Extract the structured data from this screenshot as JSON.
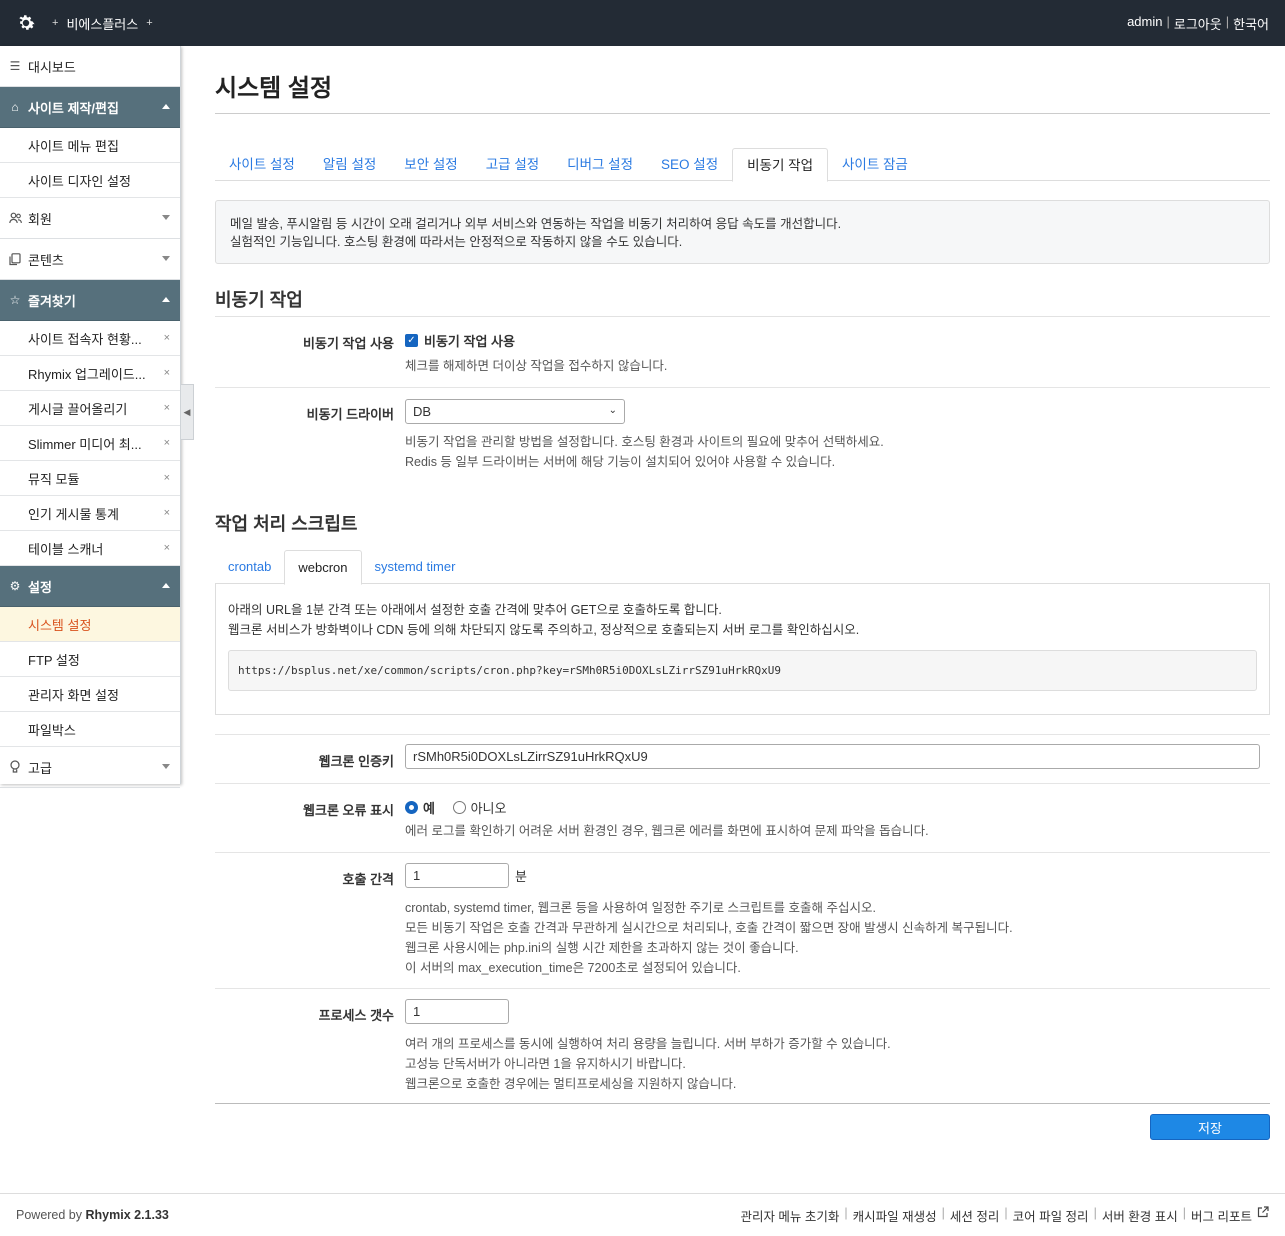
{
  "header": {
    "site_name": "비에스플러스",
    "plus": "+",
    "user": "admin",
    "logout": "로그아웃",
    "language": "한국어",
    "sep": "|"
  },
  "sidebar": {
    "dashboard": "대시보드",
    "site_group": "사이트 제작/편집",
    "site_menu_edit": "사이트 메뉴 편집",
    "site_design": "사이트 디자인 설정",
    "members": "회원",
    "contents": "콘텐츠",
    "favorites_group": "즐겨찾기",
    "favorites": [
      {
        "label": "사이트 접속자 현황..."
      },
      {
        "label": "Rhymix 업그레이드..."
      },
      {
        "label": "게시글 끌어올리기"
      },
      {
        "label": "Slimmer 미디어 최..."
      },
      {
        "label": "뮤직 모듈"
      },
      {
        "label": "인기 게시물 통계"
      },
      {
        "label": "테이블 스캐너"
      }
    ],
    "remove_mark": "×",
    "settings_group": "설정",
    "settings": [
      {
        "label": "시스템 설정"
      },
      {
        "label": "FTP 설정"
      },
      {
        "label": "관리자 화면 설정"
      },
      {
        "label": "파일박스"
      }
    ],
    "advanced": "고급"
  },
  "page": {
    "title": "시스템 설정",
    "tabs": [
      "사이트 설정",
      "알림 설정",
      "보안 설정",
      "고급 설정",
      "디버그 설정",
      "SEO 설정",
      "비동기 작업",
      "사이트 잠금"
    ],
    "active_tab": "비동기 작업",
    "notice_line1": "메일 발송, 푸시알림 등 시간이 오래 걸리거나 외부 서비스와 연동하는 작업을 비동기 처리하여 응답 속도를 개선합니다.",
    "notice_line2": "실험적인 기능입니다. 호스팅 환경에 따라서는 안정적으로 작동하지 않을 수도 있습니다."
  },
  "async": {
    "section_title": "비동기 작업",
    "use_label": "비동기 작업 사용",
    "use_checkbox_label": "비동기 작업 사용",
    "use_help": "체크를 해제하면 더이상 작업을 접수하지 않습니다.",
    "driver_label": "비동기 드라이버",
    "driver_value": "DB",
    "driver_help1": "비동기 작업을 관리할 방법을 설정합니다. 호스팅 환경과 사이트의 필요에 맞추어 선택하세요.",
    "driver_help2": "Redis 등 일부 드라이버는 서버에 해당 기능이 설치되어 있어야 사용할 수 있습니다."
  },
  "script": {
    "section_title": "작업 처리 스크립트",
    "tabs": [
      "crontab",
      "webcron",
      "systemd timer"
    ],
    "active_tab": "webcron",
    "desc1": "아래의 URL을 1분 간격 또는 아래에서 설정한 호출 간격에 맞추어 GET으로 호출하도록 합니다.",
    "desc2": "웹크론 서비스가 방화벽이나 CDN 등에 의해 차단되지 않도록 주의하고, 정상적으로 호출되는지 서버 로그를 확인하십시오.",
    "url": "https://bsplus.net/xe/common/scripts/cron.php?key=rSMh0R5i0DOXLsLZirrSZ91uHrkRQxU9"
  },
  "webcron": {
    "key_label": "웹크론 인증키",
    "key_value": "rSMh0R5i0DOXLsLZirrSZ91uHrkRQxU9",
    "error_label": "웹크론 오류 표시",
    "yes": "예",
    "no": "아니오",
    "error_help": "에러 로그를 확인하기 어려운 서버 환경인 경우, 웹크론 에러를 화면에 표시하여 문제 파악을 돕습니다.",
    "interval_label": "호출 간격",
    "interval_value": "1",
    "interval_unit": "분",
    "interval_help1": "crontab, systemd timer, 웹크론 등을 사용하여 일정한 주기로 스크립트를 호출해 주십시오.",
    "interval_help2": "모든 비동기 작업은 호출 간격과 무관하게 실시간으로 처리되나, 호출 간격이 짧으면 장애 발생시 신속하게 복구됩니다.",
    "interval_help3": "웹크론 사용시에는 php.ini의 실행 시간 제한을 초과하지 않는 것이 좋습니다.",
    "interval_help4": "이 서버의 max_execution_time은 7200초로 설정되어 있습니다.",
    "process_label": "프로세스 갯수",
    "process_value": "1",
    "process_help1": "여러 개의 프로세스를 동시에 실행하여 처리 용량을 늘립니다. 서버 부하가 증가할 수 있습니다.",
    "process_help2": "고성능 단독서버가 아니라면 1을 유지하시기 바랍니다.",
    "process_help3": "웹크론으로 호출한 경우에는 멀티프로세싱을 지원하지 않습니다."
  },
  "save_label": "저장",
  "footer": {
    "powered": "Powered by",
    "brand": "Rhymix 2.1.33",
    "links": [
      "관리자 메뉴 초기화",
      "캐시파일 재생성",
      "세션 정리",
      "코어 파일 정리",
      "서버 환경 표시",
      "버그 리포트"
    ],
    "sep": "|"
  },
  "colors": {
    "topbar": "#232b35",
    "sidebar_group": "#56707c",
    "link": "#2a7ae2",
    "active_menu": "#d9531e",
    "save_button": "#1e88e5"
  }
}
